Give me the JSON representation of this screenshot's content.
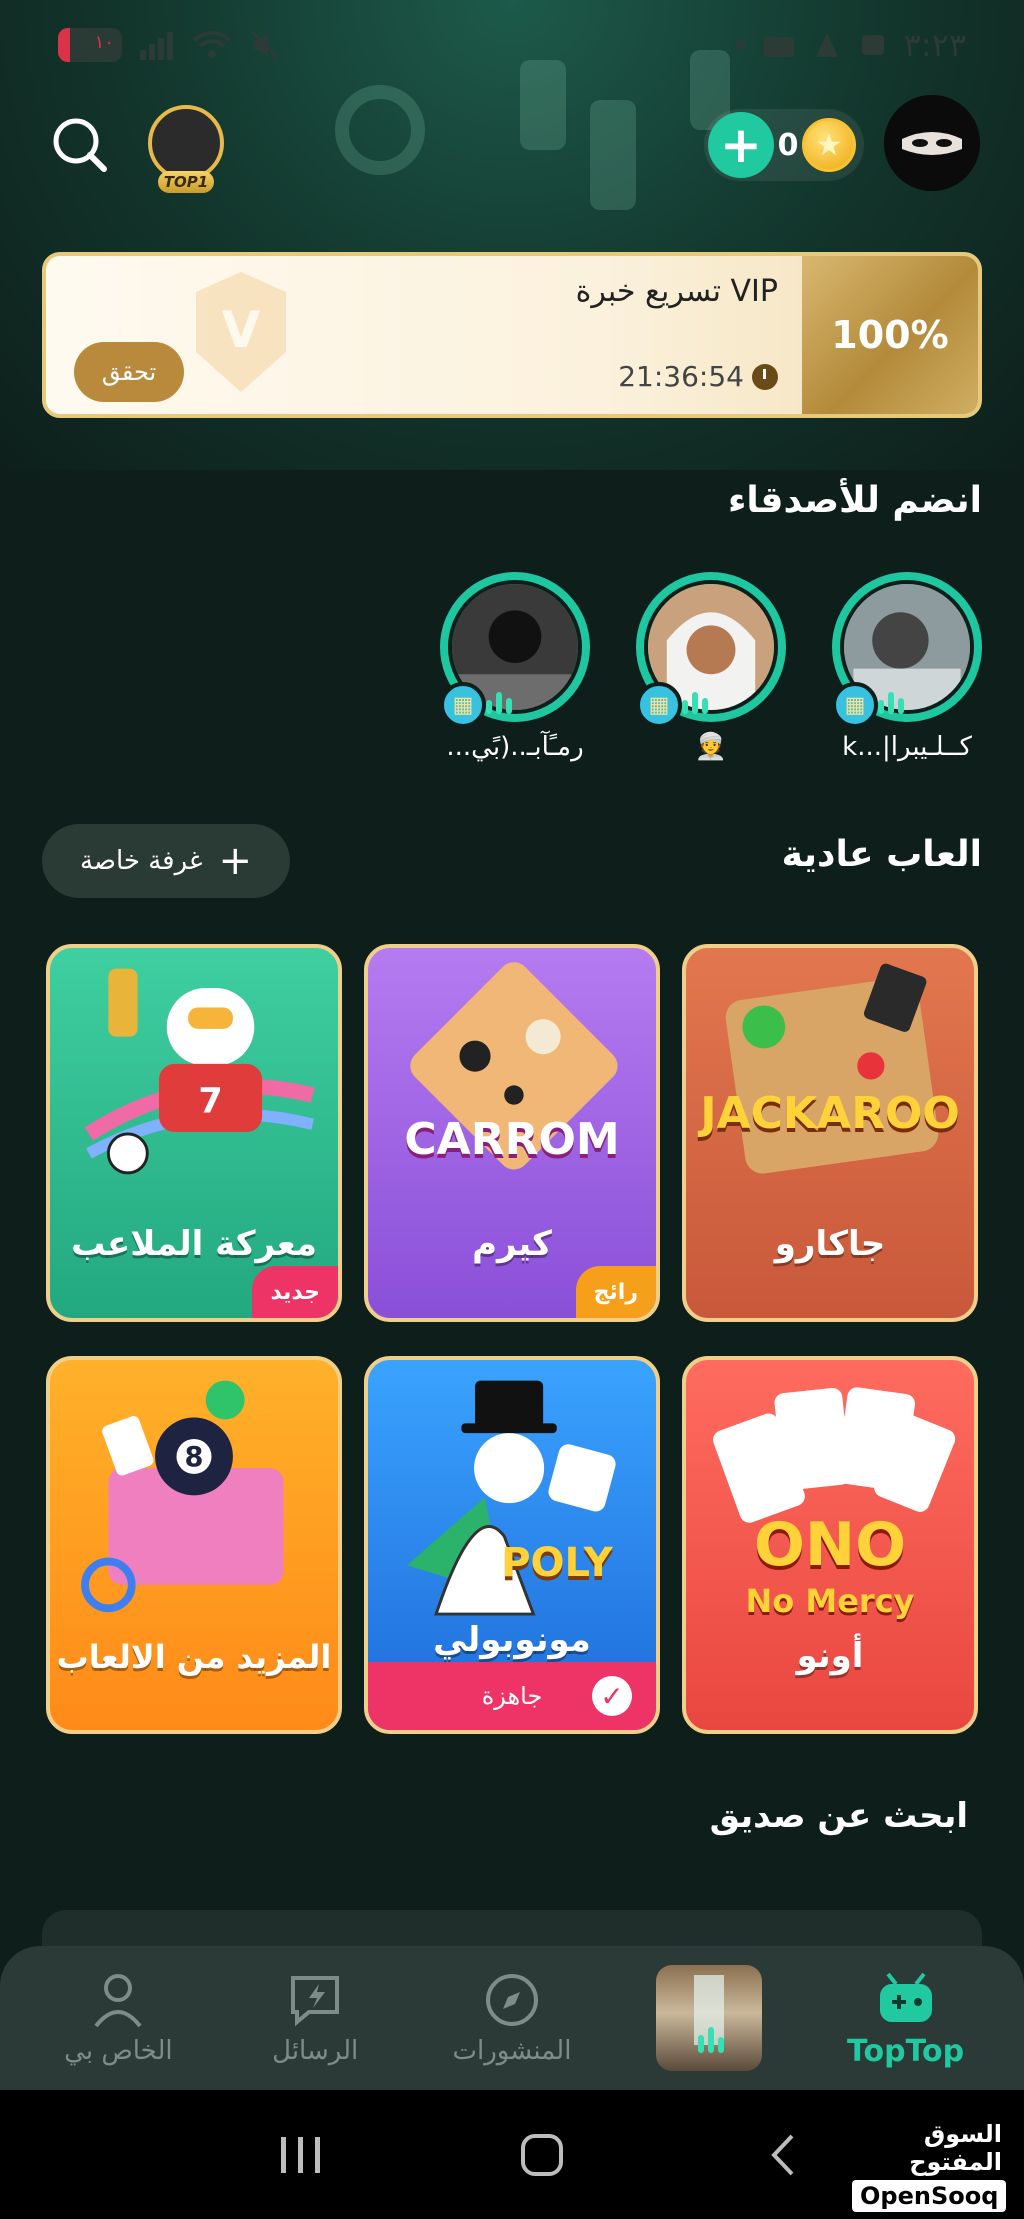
{
  "status_bar": {
    "time": "٣:٢٣",
    "battery_text": "١٠"
  },
  "header": {
    "top_badge": "TOP1",
    "coins": "0"
  },
  "vip_card": {
    "title": "تسريع خبرة VIP",
    "timer": "21:36:54",
    "check_label": "تحقق",
    "percent": "100%",
    "progress": 1.0
  },
  "friends_section": {
    "title": "انضم للأصدقاء",
    "friends": [
      {
        "name": "كــلـيبرا|...k"
      },
      {
        "name": "👳"
      },
      {
        "name": "رمـًآبـ..(بًي..."
      }
    ]
  },
  "games_section": {
    "title": "العاب عادية",
    "private_room_label": "غرفة خاصة",
    "games": [
      {
        "name": "جاكارو",
        "logo": "JACKAROO",
        "tag": ""
      },
      {
        "name": "كيرم",
        "logo": "CARROM",
        "tag": "رائج"
      },
      {
        "name": "معركة الملاعب",
        "logo": "",
        "tag": "جديد"
      },
      {
        "name": "أونو",
        "logo_line1": "ONO",
        "logo_line2": "No Mercy",
        "tag": ""
      },
      {
        "name": "مونوبولي",
        "logo": "POLY",
        "ready_label": "جاهزة"
      },
      {
        "name": "المزيد من الالعاب",
        "tag": ""
      }
    ]
  },
  "find_friend_section": {
    "title": "ابحث عن صديق"
  },
  "bottom_nav": {
    "items": [
      {
        "label": "TopTop",
        "icon": "gamepad-icon",
        "active": true
      },
      {
        "label": "",
        "icon": "room-thumbnail"
      },
      {
        "label": "المنشورات",
        "icon": "compass-icon"
      },
      {
        "label": "الرسائل",
        "icon": "message-bolt-icon"
      },
      {
        "label": "الخاص بي",
        "icon": "person-icon"
      }
    ]
  },
  "watermark": {
    "arabic": "السوق المفتوح",
    "english": "OpenSooq"
  }
}
